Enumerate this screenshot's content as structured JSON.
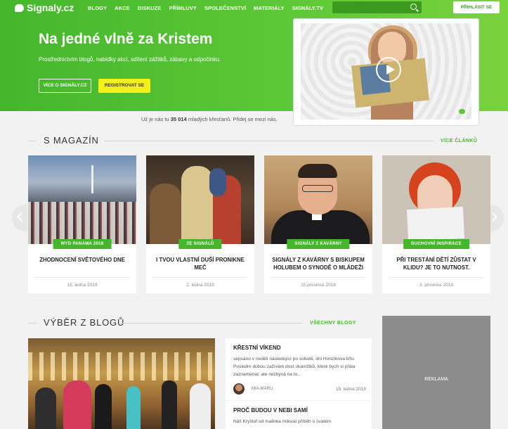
{
  "header": {
    "logo": "Signaly.cz",
    "nav": [
      "BLOGY",
      "AKCE",
      "DISKUZE",
      "PŘÍMLUVY",
      "SPOLEČENSTVÍ",
      "MATERIÁLY",
      "SIGNÁLY.TV"
    ],
    "search_placeholder": "",
    "login_label": "PŘIHLÁSIT SE"
  },
  "hero": {
    "title": "Na jedné vlně za Kristem",
    "subtitle": "Prostřednictvím blogů, nabídky akcí, sdílení zážitků, zábavy a odpočinku.",
    "about_button": "VÍCE O SIGNÁLY.CZ",
    "register_button": "REGISTROVAT SE",
    "count_prefix": "Už je nás tu",
    "count_value": "35 014",
    "count_suffix": "mladých křesťanů. Přidej se mezi nás."
  },
  "magazine": {
    "title": "S MAGAZÍN",
    "more_link": "VÍCE ČLÁNKŮ",
    "cards": [
      {
        "category": "WYD PANAMA 2019",
        "title": "ZHODNOCENÍ SVĚTOVÉHO DNE",
        "date": "15. ledna 2019"
      },
      {
        "category": "ZE SIGNÁLŮ",
        "title": "I TVOU VLASTNÍ DUŠÍ PRONIKNE MEČ",
        "date": "2. ledna 2019"
      },
      {
        "category": "SIGNÁLY Z KAVÁRNY",
        "title": "SIGNÁLY Z KAVÁRNY S BISKUPEM HOLUBEM O SYNODĚ O MLÁDEŽI",
        "date": "15.prosince 2018"
      },
      {
        "category": "DUCHOVNÍ INSPIRACE",
        "title": "PŘI TRESTÁNÍ DĚTÍ ZŮSTAT V KLIDU? JE TO NUTNOST.",
        "date": "3. prosince 2019"
      }
    ]
  },
  "blogs": {
    "title": "VÝBĚR Z BLOGŮ",
    "more_link": "VŠECHNY BLOGY",
    "posts": [
      {
        "title": "KŘESTNÍ VÍKEND",
        "excerpt": "sepsáno v neděli následující po sobotě, dni Honzíkova křtu Poslední dobou zažívám dost okamžiků, které bych si přála zaznamenat, ale nezbývá na to...",
        "author": "MIA-MARU",
        "date": "15. ledna 2019"
      },
      {
        "title": "PROČ BUDOU V NEBI SAMÍ",
        "excerpt": "Náš Kryštof od malinka miloval příběh o svatém"
      }
    ],
    "ad_label": "REKLAMA"
  }
}
